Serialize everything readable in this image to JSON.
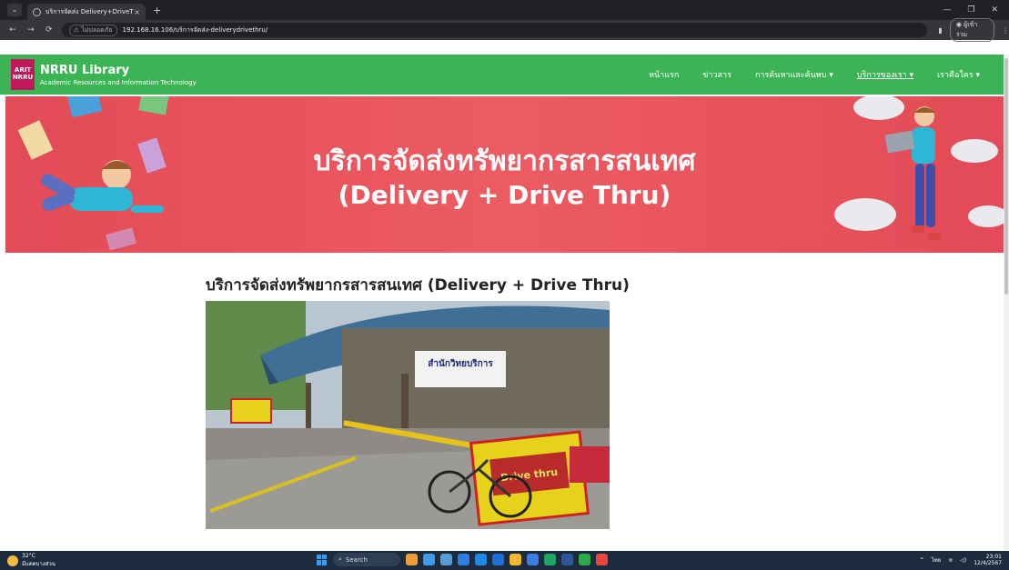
{
  "browser": {
    "tab_title": "บริการจัดส่ง Delivery+DriveThru",
    "tab_close": "×",
    "new_tab": "+",
    "url_security": "ไม่ปลอดภัย",
    "url": "192.168.16.106/บริการจัดส่ง-deliverydrivethru/",
    "profile": "ผู้เข้าร่วม"
  },
  "site": {
    "logo_lines": [
      "ARIT",
      "NRRU"
    ],
    "brand_name": "NRRU Library",
    "brand_sub": "Academic Resources and Information Technology",
    "menu": [
      {
        "label": "หน้าแรก",
        "active": false
      },
      {
        "label": "ข่าวสาร",
        "active": false
      },
      {
        "label": "การค้นหาและค้นพบ ▾",
        "active": false
      },
      {
        "label": "บริการของเรา ▾",
        "active": true
      },
      {
        "label": "เราคือใคร ▾",
        "active": false
      }
    ]
  },
  "hero": {
    "line1": "บริการจัดส่งทรัพยากรสารสนเทศ",
    "line2": "(Delivery + Drive Thru)"
  },
  "content": {
    "title": "บริการจัดส่งทรัพยากรสารสนเทศ (Delivery + Drive Thru)",
    "photo_sign_1": "สำนักวิทยบริการ",
    "photo_sign_2": "Drive thru"
  },
  "taskbar": {
    "temp": "32°C",
    "weather_text": "มีแดดบางส่วน",
    "search_label": "Search",
    "lang": "ไทย",
    "time": "23:01",
    "date": "12/4/2567"
  },
  "colors": {
    "header_green": "#3cb455",
    "hero_red": "#e24b57"
  }
}
